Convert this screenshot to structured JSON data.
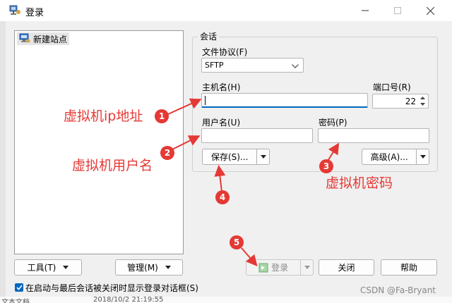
{
  "window": {
    "title": "登录"
  },
  "tree": {
    "items": [
      {
        "label": "新建站点"
      }
    ]
  },
  "session": {
    "group_label": "会话",
    "protocol_label": "文件协议(F)",
    "protocol_value": "SFTP",
    "host_label": "主机名(H)",
    "host_value": "",
    "port_label": "端口号(R)",
    "port_value": "22",
    "user_label": "用户名(U)",
    "user_value": "",
    "password_label": "密码(P)",
    "password_value": "",
    "save_label": "保存(S)...",
    "advanced_label": "高级(A)..."
  },
  "bottom": {
    "tools_label": "工具(T)",
    "manage_label": "管理(M)",
    "login_label": "登录",
    "close_label": "关闭",
    "help_label": "帮助",
    "checkbox_label": "在启动与最后会话被关闭时显示登录对话框(S)",
    "checkbox_checked": true
  },
  "background_peek": {
    "left_text": "文本文档",
    "date_text": "2018/10/2  21:19:55"
  },
  "annotations": [
    {
      "num": "1",
      "text": "虚拟机ip地址"
    },
    {
      "num": "2",
      "text": "虚拟机用户名"
    },
    {
      "num": "3",
      "text": "虚拟机密码"
    },
    {
      "num": "4",
      "text": ""
    },
    {
      "num": "5",
      "text": ""
    }
  ],
  "watermark": "CSDN @Fa-Bryant",
  "colors": {
    "annotation": "#e53935",
    "accent": "#0067c0"
  }
}
